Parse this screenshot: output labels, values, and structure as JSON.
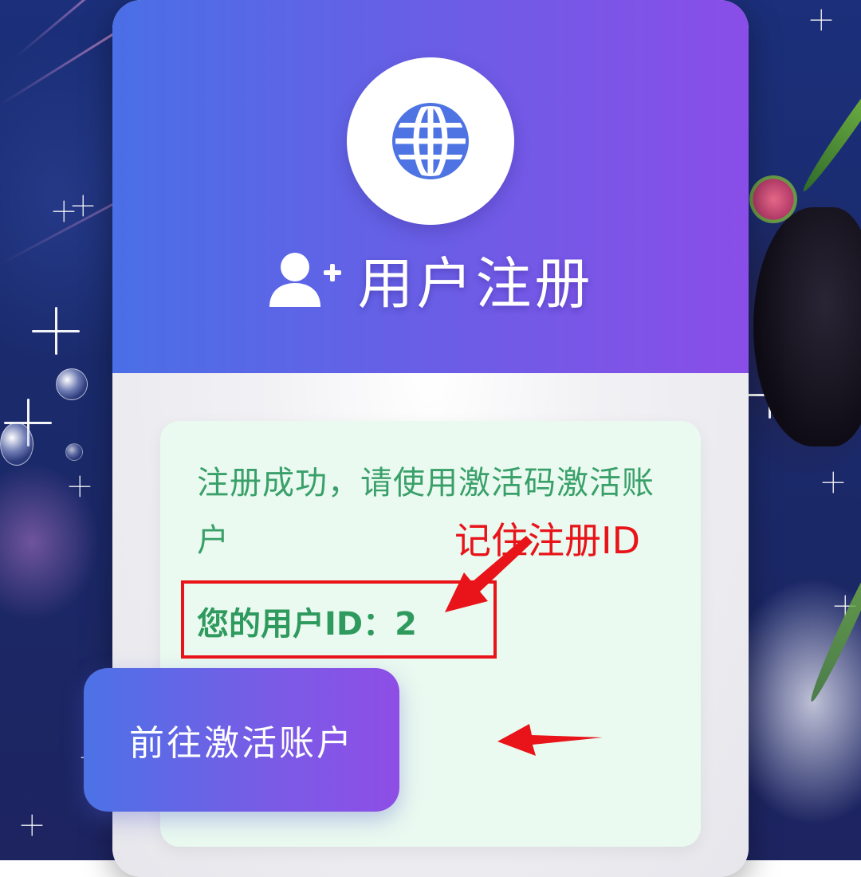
{
  "header": {
    "title": "用户注册",
    "logo_icon": "globe-icon",
    "title_icon": "user-add-icon"
  },
  "alert": {
    "message": "注册成功，请使用激活码激活账户",
    "user_id_label": "您的用户ID：",
    "user_id_value": "2",
    "user_id_text": "您的用户ID：2"
  },
  "actions": {
    "goto_activate_label": "前往激活账户"
  },
  "annotations": {
    "remember_label": "记住注册ID",
    "color": "#e8141a"
  },
  "colors": {
    "header_gradient_start": "#4a6fe6",
    "header_gradient_end": "#8a4ee8",
    "success_text": "#3aa06a",
    "alert_bg": "#eafaf0"
  }
}
